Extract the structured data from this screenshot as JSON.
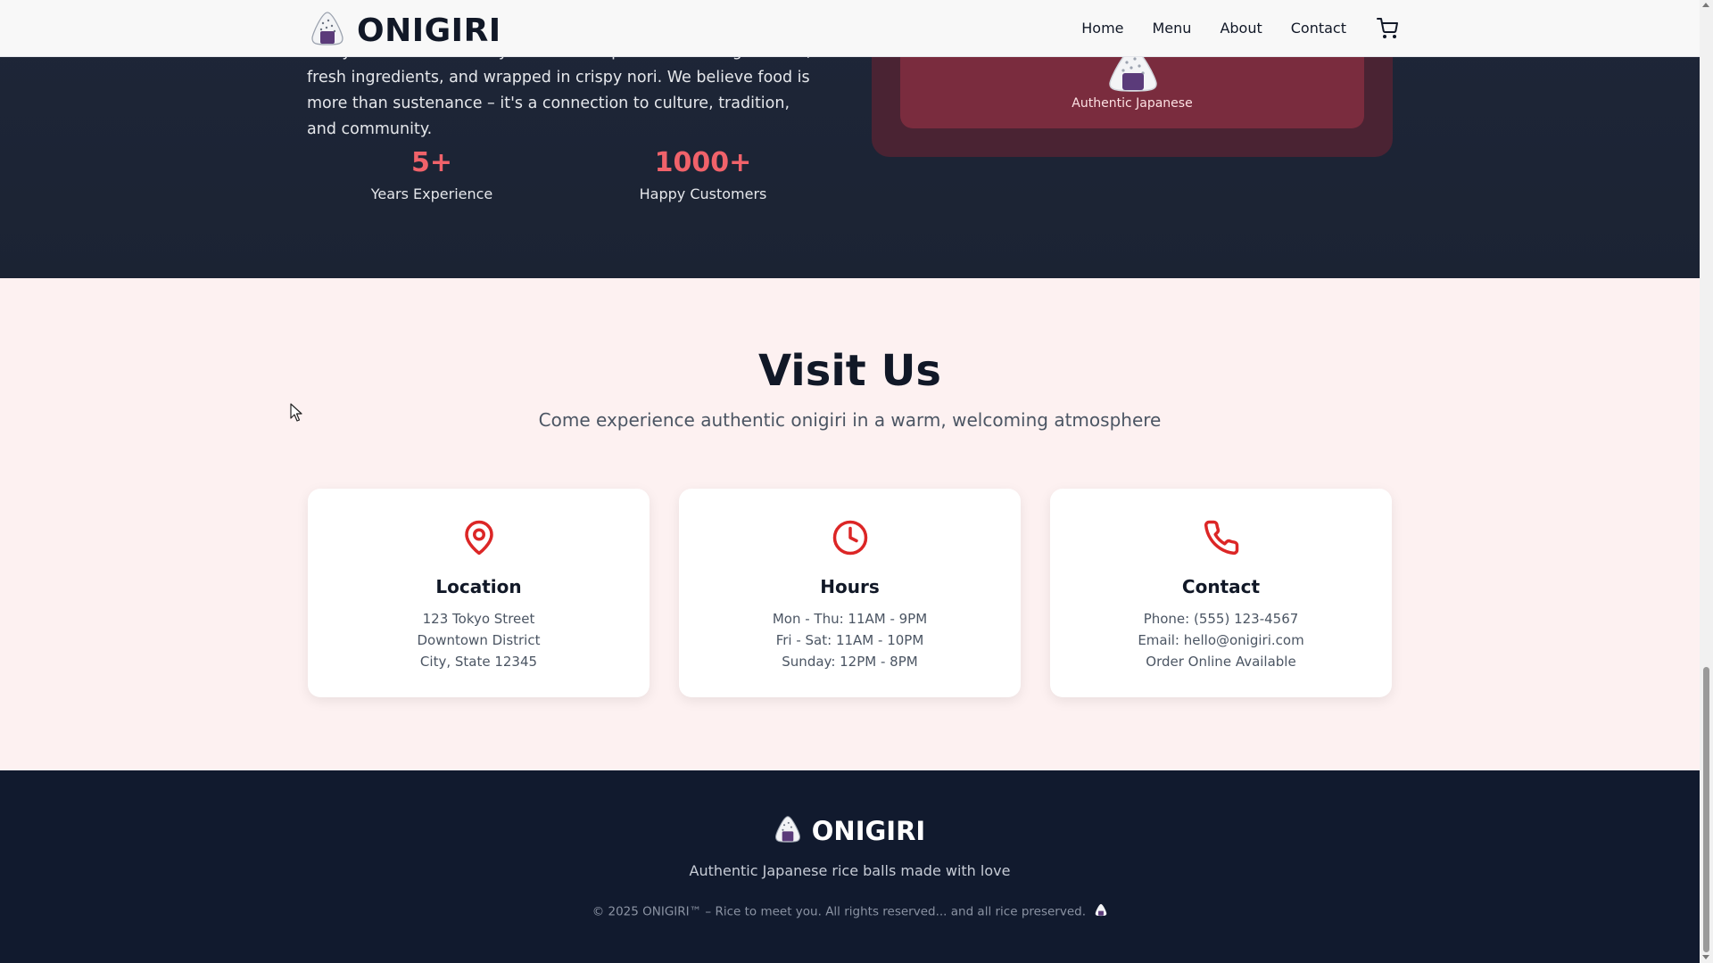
{
  "header": {
    "brand": "ONIGIRI",
    "nav": [
      "Home",
      "Menu",
      "About",
      "Contact"
    ]
  },
  "about": {
    "text": "Every rice ball is carefully crafted with premium short-grain rice, fresh ingredients, and wrapped in crispy nori. We believe food is more than sustenance – it's a connection to culture, tradition, and community.",
    "stats": [
      {
        "value": "5+",
        "label": "Years Experience"
      },
      {
        "value": "1000+",
        "label": "Happy Customers"
      }
    ],
    "feature_caption": "Authentic Japanese"
  },
  "visit": {
    "title": "Visit Us",
    "subtitle": "Come experience authentic onigiri in a warm, welcoming atmosphere",
    "cards": [
      {
        "title": "Location",
        "lines": [
          "123 Tokyo Street",
          "Downtown District",
          "City, State 12345"
        ]
      },
      {
        "title": "Hours",
        "lines": [
          "Mon - Thu: 11AM - 9PM",
          "Fri - Sat: 11AM - 10PM",
          "Sunday: 12PM - 8PM"
        ]
      },
      {
        "title": "Contact",
        "lines": [
          "Phone: (555) 123-4567",
          "Email: hello@onigiri.com",
          "Order Online Available"
        ]
      }
    ]
  },
  "footer": {
    "brand": "ONIGIRI",
    "tagline": "Authentic Japanese rice balls made with love",
    "copyright": "© 2025 ONIGIRI™ – Rice to meet you. All rights reserved... and all rice preserved."
  },
  "colors": {
    "accent": "#f0626a",
    "icon_red": "#dc2626",
    "dark_bg": "#1e293b",
    "footer_bg": "#111a2e",
    "visit_bg": "#fdf1f1"
  },
  "icons": {
    "brand": "onigiri-icon",
    "cart": "cart-icon",
    "location": "map-pin-icon",
    "hours": "clock-icon",
    "contact": "phone-icon"
  }
}
